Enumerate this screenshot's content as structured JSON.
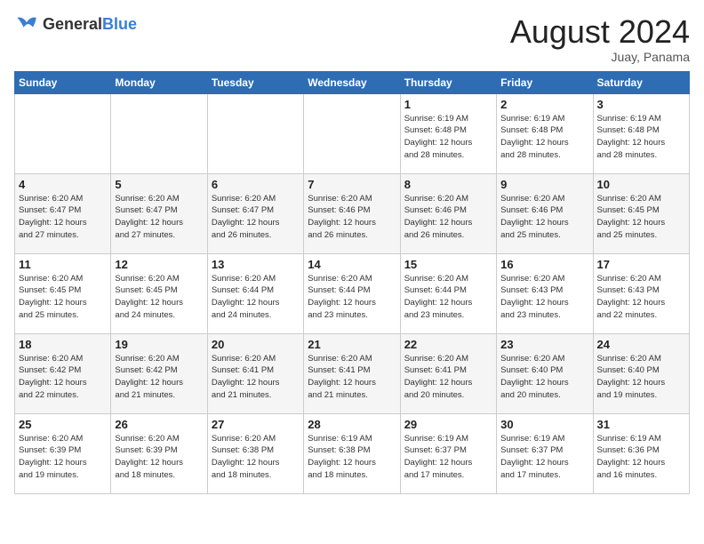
{
  "header": {
    "logo_general": "General",
    "logo_blue": "Blue",
    "month_year": "August 2024",
    "location": "Juay, Panama"
  },
  "calendar": {
    "weekdays": [
      "Sunday",
      "Monday",
      "Tuesday",
      "Wednesday",
      "Thursday",
      "Friday",
      "Saturday"
    ],
    "weeks": [
      [
        {
          "day": "",
          "info": ""
        },
        {
          "day": "",
          "info": ""
        },
        {
          "day": "",
          "info": ""
        },
        {
          "day": "",
          "info": ""
        },
        {
          "day": "1",
          "info": "Sunrise: 6:19 AM\nSunset: 6:48 PM\nDaylight: 12 hours\nand 28 minutes."
        },
        {
          "day": "2",
          "info": "Sunrise: 6:19 AM\nSunset: 6:48 PM\nDaylight: 12 hours\nand 28 minutes."
        },
        {
          "day": "3",
          "info": "Sunrise: 6:19 AM\nSunset: 6:48 PM\nDaylight: 12 hours\nand 28 minutes."
        }
      ],
      [
        {
          "day": "4",
          "info": "Sunrise: 6:20 AM\nSunset: 6:47 PM\nDaylight: 12 hours\nand 27 minutes."
        },
        {
          "day": "5",
          "info": "Sunrise: 6:20 AM\nSunset: 6:47 PM\nDaylight: 12 hours\nand 27 minutes."
        },
        {
          "day": "6",
          "info": "Sunrise: 6:20 AM\nSunset: 6:47 PM\nDaylight: 12 hours\nand 26 minutes."
        },
        {
          "day": "7",
          "info": "Sunrise: 6:20 AM\nSunset: 6:46 PM\nDaylight: 12 hours\nand 26 minutes."
        },
        {
          "day": "8",
          "info": "Sunrise: 6:20 AM\nSunset: 6:46 PM\nDaylight: 12 hours\nand 26 minutes."
        },
        {
          "day": "9",
          "info": "Sunrise: 6:20 AM\nSunset: 6:46 PM\nDaylight: 12 hours\nand 25 minutes."
        },
        {
          "day": "10",
          "info": "Sunrise: 6:20 AM\nSunset: 6:45 PM\nDaylight: 12 hours\nand 25 minutes."
        }
      ],
      [
        {
          "day": "11",
          "info": "Sunrise: 6:20 AM\nSunset: 6:45 PM\nDaylight: 12 hours\nand 25 minutes."
        },
        {
          "day": "12",
          "info": "Sunrise: 6:20 AM\nSunset: 6:45 PM\nDaylight: 12 hours\nand 24 minutes."
        },
        {
          "day": "13",
          "info": "Sunrise: 6:20 AM\nSunset: 6:44 PM\nDaylight: 12 hours\nand 24 minutes."
        },
        {
          "day": "14",
          "info": "Sunrise: 6:20 AM\nSunset: 6:44 PM\nDaylight: 12 hours\nand 23 minutes."
        },
        {
          "day": "15",
          "info": "Sunrise: 6:20 AM\nSunset: 6:44 PM\nDaylight: 12 hours\nand 23 minutes."
        },
        {
          "day": "16",
          "info": "Sunrise: 6:20 AM\nSunset: 6:43 PM\nDaylight: 12 hours\nand 23 minutes."
        },
        {
          "day": "17",
          "info": "Sunrise: 6:20 AM\nSunset: 6:43 PM\nDaylight: 12 hours\nand 22 minutes."
        }
      ],
      [
        {
          "day": "18",
          "info": "Sunrise: 6:20 AM\nSunset: 6:42 PM\nDaylight: 12 hours\nand 22 minutes."
        },
        {
          "day": "19",
          "info": "Sunrise: 6:20 AM\nSunset: 6:42 PM\nDaylight: 12 hours\nand 21 minutes."
        },
        {
          "day": "20",
          "info": "Sunrise: 6:20 AM\nSunset: 6:41 PM\nDaylight: 12 hours\nand 21 minutes."
        },
        {
          "day": "21",
          "info": "Sunrise: 6:20 AM\nSunset: 6:41 PM\nDaylight: 12 hours\nand 21 minutes."
        },
        {
          "day": "22",
          "info": "Sunrise: 6:20 AM\nSunset: 6:41 PM\nDaylight: 12 hours\nand 20 minutes."
        },
        {
          "day": "23",
          "info": "Sunrise: 6:20 AM\nSunset: 6:40 PM\nDaylight: 12 hours\nand 20 minutes."
        },
        {
          "day": "24",
          "info": "Sunrise: 6:20 AM\nSunset: 6:40 PM\nDaylight: 12 hours\nand 19 minutes."
        }
      ],
      [
        {
          "day": "25",
          "info": "Sunrise: 6:20 AM\nSunset: 6:39 PM\nDaylight: 12 hours\nand 19 minutes."
        },
        {
          "day": "26",
          "info": "Sunrise: 6:20 AM\nSunset: 6:39 PM\nDaylight: 12 hours\nand 18 minutes."
        },
        {
          "day": "27",
          "info": "Sunrise: 6:20 AM\nSunset: 6:38 PM\nDaylight: 12 hours\nand 18 minutes."
        },
        {
          "day": "28",
          "info": "Sunrise: 6:19 AM\nSunset: 6:38 PM\nDaylight: 12 hours\nand 18 minutes."
        },
        {
          "day": "29",
          "info": "Sunrise: 6:19 AM\nSunset: 6:37 PM\nDaylight: 12 hours\nand 17 minutes."
        },
        {
          "day": "30",
          "info": "Sunrise: 6:19 AM\nSunset: 6:37 PM\nDaylight: 12 hours\nand 17 minutes."
        },
        {
          "day": "31",
          "info": "Sunrise: 6:19 AM\nSunset: 6:36 PM\nDaylight: 12 hours\nand 16 minutes."
        }
      ]
    ]
  }
}
